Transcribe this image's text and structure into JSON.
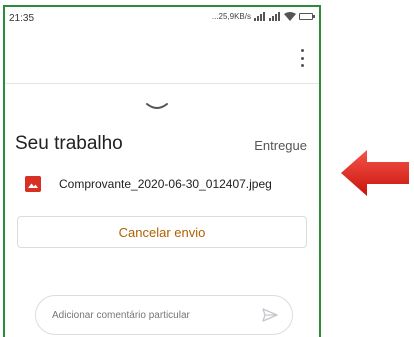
{
  "status_bar": {
    "time": "21:35",
    "network_speed": "...25,9KB/s"
  },
  "assignment": {
    "section_title": "Seu trabalho",
    "status": "Entregue",
    "attachment_name": "Comprovante_2020-06-30_012407.jpeg",
    "cancel_label": "Cancelar envio"
  },
  "comment": {
    "placeholder": "Adicionar comentário particular"
  },
  "colors": {
    "frame_border": "#2e8b3a",
    "image_icon": "#d93025",
    "cancel_text": "#b06000",
    "arrow": "#e8231a"
  },
  "icons": {
    "menu": "more-vert-icon",
    "collapse": "chevron-down-icon",
    "attachment": "image-file-icon",
    "send": "send-icon",
    "annotation": "left-arrow-icon"
  }
}
